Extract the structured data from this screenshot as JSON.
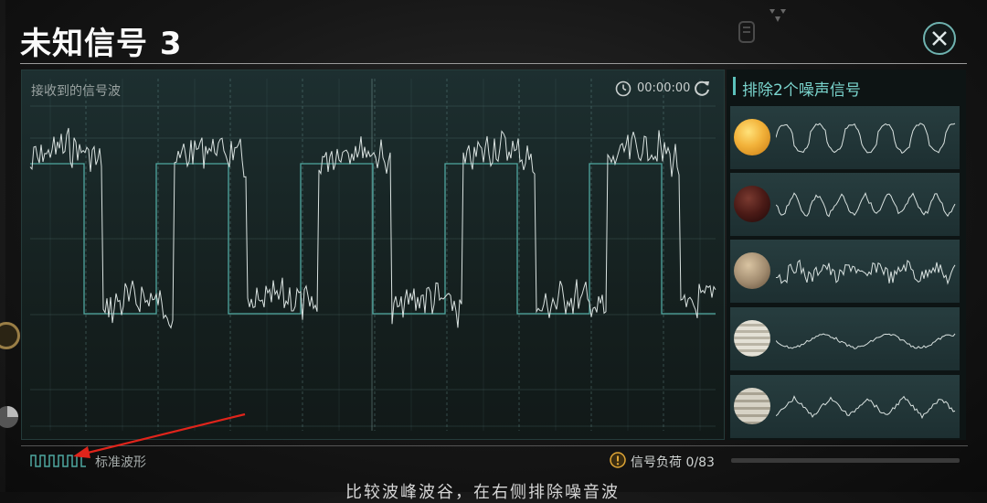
{
  "title": "未知信号 3",
  "wave_panel": {
    "label": "接收到的信号波",
    "timer": "00:00:00"
  },
  "noise_panel": {
    "header": "排除2个噪声信号",
    "signals": [
      {
        "planet": "sun",
        "color": "#f2b23a"
      },
      {
        "planet": "lava-planet",
        "color": "#7a2a22"
      },
      {
        "planet": "rocky-planet",
        "color": "#a08a6e"
      },
      {
        "planet": "gas-giant",
        "color": "#cfcabc"
      },
      {
        "planet": "gas-giant-2",
        "color": "#bdb7a8"
      }
    ]
  },
  "footer": {
    "standard_wave_label": "标准波形",
    "signal_load": "信号负荷 0/83",
    "hint": "比较波峰波谷，在右侧排除噪音波"
  },
  "colors": {
    "accent": "#5cc1bb",
    "wave": "#d9e2e0",
    "standard_wave": "#4fa7a0",
    "annotation_arrow": "#e0241b"
  }
}
